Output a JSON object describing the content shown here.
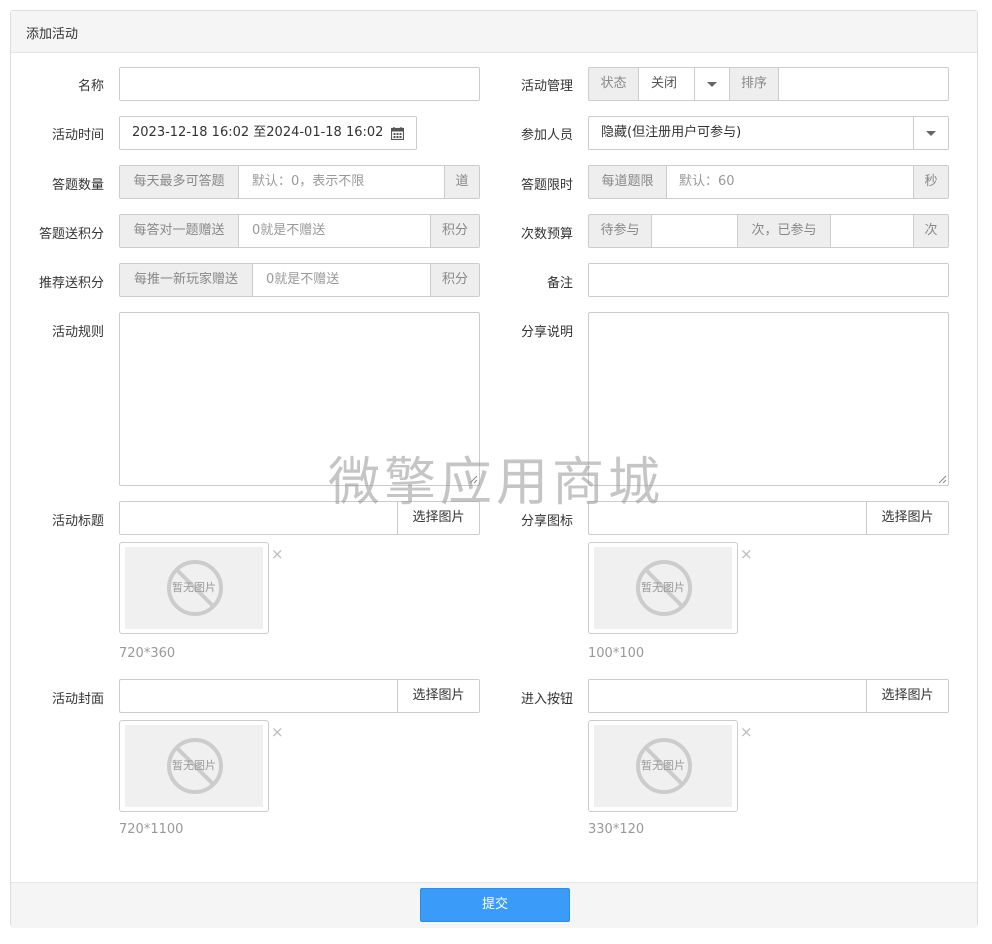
{
  "header": {
    "title": "添加活动"
  },
  "labels": {
    "name": "名称",
    "activity_manage": "活动管理",
    "activity_time": "活动时间",
    "participants": "参加人员",
    "answer_count": "答题数量",
    "answer_limit": "答题限时",
    "answer_points": "答题送积分",
    "count_budget": "次数预算",
    "referral_points": "推荐送积分",
    "remark": "备注",
    "rules": "活动规则",
    "share_desc": "分享说明",
    "activity_title": "活动标题",
    "share_icon": "分享图标",
    "activity_cover": "活动封面",
    "enter_button": "进入按钮"
  },
  "manage": {
    "status_addon": "状态",
    "status_value": "关闭",
    "sort_addon": "排序"
  },
  "time": {
    "value": "2023-12-18 16:02 至2024-01-18 16:02"
  },
  "participants": {
    "value": "隐藏(但注册用户可参与)"
  },
  "answer_count": {
    "prefix": "每天最多可答题",
    "placeholder": "默认：0，表示不限",
    "suffix": "道"
  },
  "answer_limit": {
    "prefix": "每道题限",
    "placeholder": "默认：60",
    "suffix": "秒"
  },
  "answer_points": {
    "prefix": "每答对一题赠送",
    "placeholder": "0就是不赠送",
    "suffix": "积分"
  },
  "budget": {
    "prefix": "待参与",
    "middle": "次，已参与",
    "suffix": "次"
  },
  "referral_points": {
    "prefix": "每推一新玩家赠送",
    "placeholder": "0就是不赠送",
    "suffix": "积分"
  },
  "pick_label": "选择图片",
  "no_image_text": "暂无图片",
  "close_glyph": "×",
  "sizes": {
    "activity_title": "720*360",
    "share_icon": "100*100",
    "activity_cover": "720*1100",
    "enter_button": "330*120"
  },
  "footer": {
    "submit": "提交"
  },
  "watermark": "微擎应用商城",
  "colors": {
    "primary": "#3a9cf8",
    "addon_bg": "#eeeeee",
    "border": "#cccccc"
  }
}
